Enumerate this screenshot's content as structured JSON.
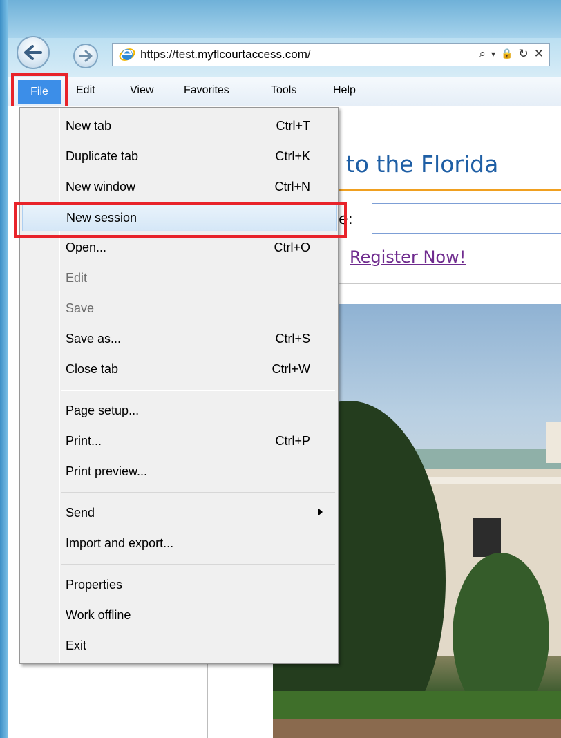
{
  "browser": {
    "address": {
      "prefix": "https://test.",
      "domain": "myflcourtaccess.com",
      "suffix": "/"
    },
    "address_tools": {
      "search": "⌕",
      "dropdown": "▾",
      "lock": "🔒",
      "refresh": "↻",
      "close": "✕"
    }
  },
  "menubar": {
    "items": [
      "File",
      "Edit",
      "View",
      "Favorites",
      "Tools",
      "Help"
    ]
  },
  "file_menu": {
    "items": [
      {
        "label": "New tab",
        "shortcut": "Ctrl+T"
      },
      {
        "label": "Duplicate tab",
        "shortcut": "Ctrl+K"
      },
      {
        "label": "New window",
        "shortcut": "Ctrl+N"
      },
      {
        "label": "New session",
        "shortcut": ""
      },
      {
        "label": "Open...",
        "shortcut": "Ctrl+O"
      },
      {
        "label": "Edit",
        "shortcut": ""
      },
      {
        "label": "Save",
        "shortcut": ""
      },
      {
        "label": "Save as...",
        "shortcut": "Ctrl+S"
      },
      {
        "label": "Close tab",
        "shortcut": "Ctrl+W"
      },
      {
        "label": "Page setup...",
        "shortcut": ""
      },
      {
        "label": "Print...",
        "shortcut": "Ctrl+P"
      },
      {
        "label": "Print preview...",
        "shortcut": ""
      },
      {
        "label": "Send",
        "shortcut": ""
      },
      {
        "label": "Import and export...",
        "shortcut": ""
      },
      {
        "label": "Properties",
        "shortcut": ""
      },
      {
        "label": "Work offline",
        "shortcut": ""
      },
      {
        "label": "Exit",
        "shortcut": ""
      }
    ]
  },
  "page": {
    "welcome_fragment": "e to the Florida",
    "username_label_fragment": "e:",
    "register_link": "Register Now!"
  },
  "colors": {
    "highlight": "#e8232a",
    "menu_active": "#3c8ee8",
    "title_blue": "#1f5fa5",
    "accent_orange": "#f0a020",
    "visited_link": "#6f2b8e"
  }
}
